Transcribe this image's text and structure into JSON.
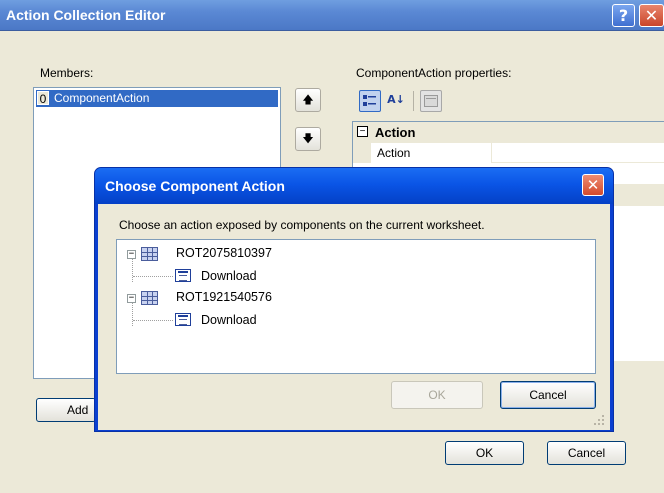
{
  "outer": {
    "title": "Action Collection Editor",
    "help_glyph": "?",
    "close_glyph": "✕",
    "members_label": "Members:",
    "properties_label": "ComponentAction properties:",
    "members": [
      {
        "index": "0",
        "label": "ComponentAction"
      }
    ],
    "up_glyph": "🡅",
    "down_glyph": "🡇",
    "add_label": "Add",
    "ok_label": "OK",
    "cancel_label": "Cancel",
    "property_grid": {
      "category": "Action",
      "category_toggle": "−",
      "rows": [
        {
          "name": "Action",
          "value": ""
        }
      ]
    },
    "toolbar": {
      "categorized_icon": "categorized-icon",
      "alphabetical_glyph": "A↓",
      "property_pages_icon": "property-pages-icon"
    }
  },
  "inner": {
    "title": "Choose Component Action",
    "close_glyph": "✕",
    "prompt": "Choose an action exposed by components on the current worksheet.",
    "tree": [
      {
        "label": "ROT2075810397",
        "toggle": "−",
        "children": [
          {
            "label": "Download"
          }
        ]
      },
      {
        "label": "ROT1921540576",
        "toggle": "−",
        "children": [
          {
            "label": "Download"
          }
        ]
      }
    ],
    "ok_label": "OK",
    "cancel_label": "Cancel",
    "ok_enabled": false
  },
  "colors": {
    "title_bar_active": "#0a55e6",
    "title_bar_inactive": "#5a88d4",
    "selection": "#316ac5",
    "face": "#ece9d8"
  }
}
